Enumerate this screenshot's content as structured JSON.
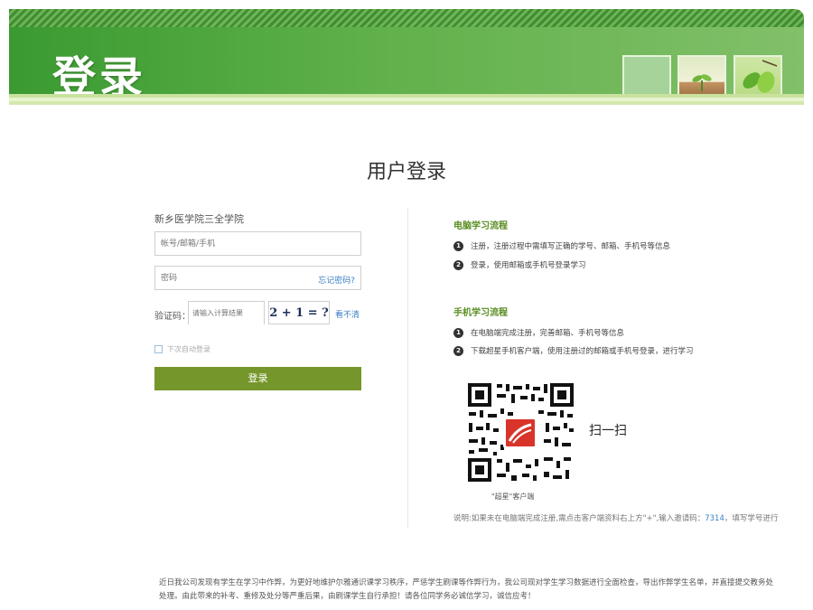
{
  "banner": {
    "title": "登录"
  },
  "main": {
    "page_title": "用户登录"
  },
  "login_form": {
    "school_name": "新乡医学院三全学院",
    "account_placeholder": "帐号/邮箱/手机",
    "password_placeholder": "密码",
    "forgot_password": "忘记密码?",
    "captcha_label": "验证码：",
    "captcha_placeholder": "请输入计算结果",
    "captcha_expression": "2 + 1 = ?",
    "captcha_refresh": "看不清",
    "remember_label": "下次自动登录",
    "login_button": "登录"
  },
  "pc_flow": {
    "title": "电脑学习流程",
    "steps": [
      {
        "num": "1",
        "text": "注册，注册过程中需填写正确的学号、邮箱、手机号等信息"
      },
      {
        "num": "2",
        "text": "登录，使用邮箱或手机号登录学习"
      }
    ]
  },
  "mobile_flow": {
    "title": "手机学习流程",
    "steps": [
      {
        "num": "1",
        "text": "在电脑端完成注册，完善邮箱、手机号等信息"
      },
      {
        "num": "2",
        "text": "下载超星手机客户端，使用注册过的邮箱或手机号登录，进行学习"
      }
    ]
  },
  "qr": {
    "scan_text": "扫一扫",
    "caption": "\"超星\"客户端"
  },
  "note": {
    "prefix": "说明:如果未在电脑端完成注册,需点击客户端资料右上方\"+\",输入邀请码：",
    "invite_code": "7314",
    "suffix": "，填写学号进行"
  },
  "notice": {
    "text": "近日我公司发现有学生在学习中作弊，为更好地维护尔雅通识课学习秩序，严惩学生刷课等作弊行为，我公司现对学生学习数据进行全面检查，导出作弊学生名单，并直接提交教务处处理。由此带来的补考、重修及处分等严重后果，由刷课学生自行承担！请各位同学务必诚信学习，诚信应考！"
  },
  "colors": {
    "banner_green": "#3a9a31",
    "button_green": "#75962a",
    "section_title": "#5a8d22",
    "link_blue": "#3b7fc4"
  }
}
